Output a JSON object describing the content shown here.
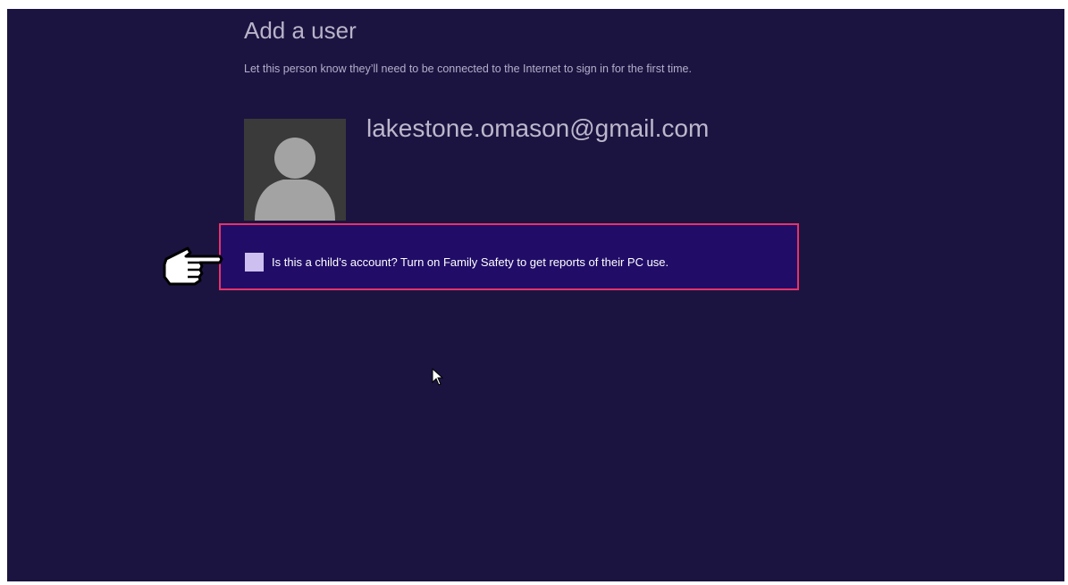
{
  "page": {
    "title": "Add a user",
    "subtitle": "Let this person know they’ll need to be connected to the Internet to sign in for the first time."
  },
  "account": {
    "email": "lakestone.omason@gmail.com",
    "avatar_icon": "user-avatar-icon"
  },
  "family_safety": {
    "checkbox_label": "Is this a child’s account? Turn on Family Safety to get reports of their PC use.",
    "checked": false
  },
  "overlays": {
    "pointer_icon": "pointing-hand-icon",
    "cursor_icon": "mouse-cursor-icon",
    "highlight_color": "#e6336a"
  },
  "colors": {
    "background": "#1b1440",
    "highlight_fill": "#210d68",
    "checkbox_fill": "#cdbff0"
  }
}
